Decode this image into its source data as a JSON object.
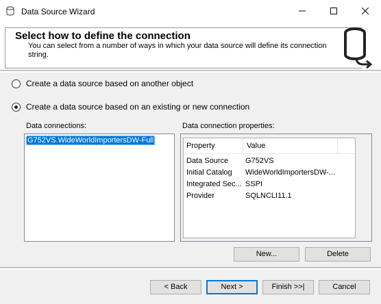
{
  "window": {
    "title": "Data Source Wizard"
  },
  "header": {
    "title": "Select how to define the connection",
    "description": "You can select from a number of ways in which your data source will define its connection string."
  },
  "options": {
    "another_object": "Create a data source based on another object",
    "existing_connection": "Create a data source based on an existing or new connection",
    "selected": "existing_connection"
  },
  "connections": {
    "label": "Data connections:",
    "items": [
      "G752VS.WideWorldImportersDW-Full"
    ],
    "selected_index": 0
  },
  "properties": {
    "label": "Data connection properties:",
    "columns": [
      "Property",
      "Value"
    ],
    "rows": [
      {
        "property": "Data Source",
        "value": "G752VS"
      },
      {
        "property": "Initial Catalog",
        "value": "WideWorldImportersDW-..."
      },
      {
        "property": "Integrated Sec...",
        "value": "SSPI"
      },
      {
        "property": "Provider",
        "value": "SQLNCLI11.1"
      }
    ]
  },
  "buttons": {
    "new": "New...",
    "delete": "Delete",
    "back": "< Back",
    "next": "Next >",
    "finish": "Finish >>|",
    "cancel": "Cancel"
  },
  "icons": {
    "app": "database-icon",
    "header": "database-arrow-icon"
  },
  "colors": {
    "selection": "#0078d7",
    "dialog_bg": "#f0f0f0"
  }
}
